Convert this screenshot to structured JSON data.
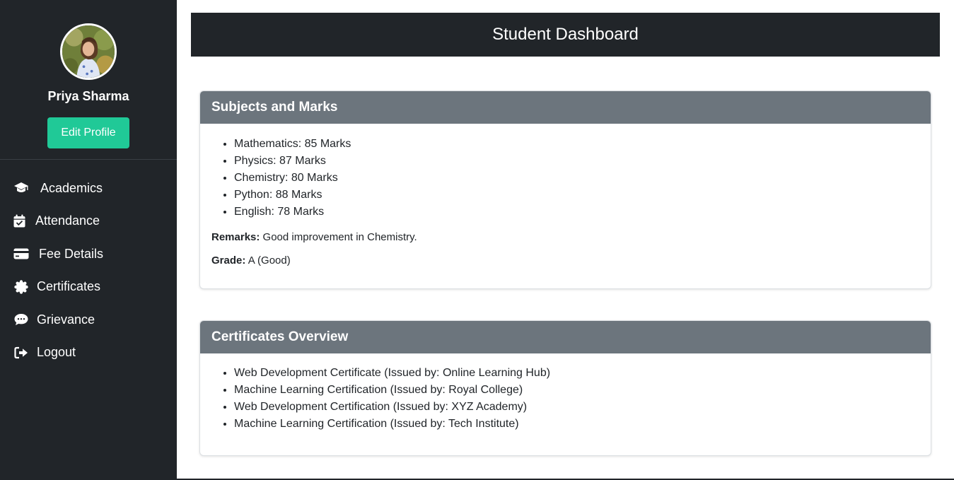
{
  "profile": {
    "name": "Priya Sharma",
    "edit_label": "Edit Profile"
  },
  "nav": [
    {
      "label": "Academics",
      "icon": "graduation-cap-icon"
    },
    {
      "label": "Attendance",
      "icon": "calendar-check-icon"
    },
    {
      "label": "Fee Details",
      "icon": "credit-card-icon"
    },
    {
      "label": "Certificates",
      "icon": "certificate-icon"
    },
    {
      "label": "Grievance",
      "icon": "comment-icon"
    },
    {
      "label": "Logout",
      "icon": "logout-icon"
    }
  ],
  "header": {
    "title": "Student Dashboard"
  },
  "subjects_card": {
    "title": "Subjects and Marks",
    "items": [
      "Mathematics: 85 Marks",
      "Physics: 87 Marks",
      "Chemistry: 80 Marks",
      "Python: 88 Marks",
      "English: 78 Marks"
    ],
    "remarks_label": "Remarks:",
    "remarks_value": " Good improvement in Chemistry.",
    "grade_label": "Grade:",
    "grade_value": " A (Good)"
  },
  "certificates_card": {
    "title": "Certificates Overview",
    "items": [
      "Web Development Certificate (Issued by: Online Learning Hub)",
      "Machine Learning Certification (Issued by: Royal College)",
      "Web Development Certification (Issued by: XYZ Academy)",
      "Machine Learning Certification (Issued by: Tech Institute)"
    ]
  },
  "colors": {
    "sidebar_bg": "#212529",
    "accent": "#20c997",
    "card_header": "#6c757d"
  }
}
